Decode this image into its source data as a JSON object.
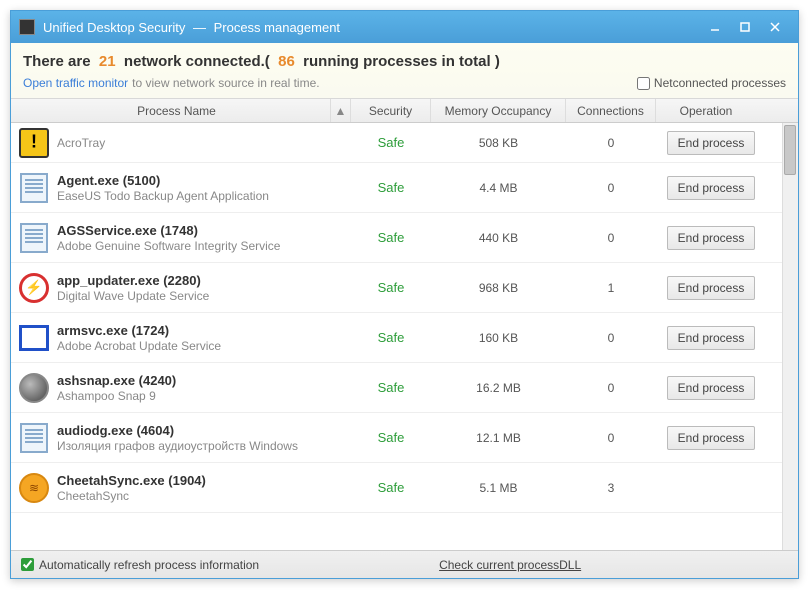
{
  "titlebar": {
    "app": "Unified Desktop Security",
    "separator": "—",
    "section": "Process management"
  },
  "header": {
    "prefix": "There are",
    "network_count": "21",
    "mid": "network connected.(",
    "total_count": "86",
    "suffix": "running processes in total )",
    "link": "Open traffic monitor",
    "link_tail": "to view network source in real time.",
    "checkbox_label": "Netconnected processes"
  },
  "columns": {
    "name": "Process Name",
    "sort": "▲",
    "security": "Security",
    "memory": "Memory Occupancy",
    "connections": "Connections",
    "operation": "Operation"
  },
  "safe_label": "Safe",
  "end_label": "End process",
  "rows": [
    {
      "icon": "ic-warn",
      "title": "",
      "sub": "AcroTray",
      "mem": "508 KB",
      "con": "0",
      "first": true
    },
    {
      "icon": "ic-doc",
      "title": "Agent.exe (5100)",
      "sub": "EaseUS Todo Backup Agent Application",
      "mem": "4.4 MB",
      "con": "0"
    },
    {
      "icon": "ic-doc",
      "title": "AGSService.exe (1748)",
      "sub": "Adobe Genuine Software Integrity Service",
      "mem": "440 KB",
      "con": "0"
    },
    {
      "icon": "ic-bolt",
      "title": "app_updater.exe (2280)",
      "sub": "Digital Wave Update Service",
      "mem": "968 KB",
      "con": "1"
    },
    {
      "icon": "ic-rect",
      "title": "armsvc.exe (1724)",
      "sub": "Adobe Acrobat Update Service",
      "mem": "160 KB",
      "con": "0"
    },
    {
      "icon": "ic-ball",
      "title": "ashsnap.exe (4240)",
      "sub": "Ashampoo Snap 9",
      "mem": "16.2 MB",
      "con": "0"
    },
    {
      "icon": "ic-doc",
      "title": "audiodg.exe (4604)",
      "sub": "Изоляция графов аудиоустройств Windows",
      "mem": "12.1 MB",
      "con": "0"
    },
    {
      "icon": "ic-cheetah",
      "title": "CheetahSync.exe (1904)",
      "sub": "CheetahSync",
      "mem": "5.1 MB",
      "con": "3",
      "last": true
    }
  ],
  "footer": {
    "auto_refresh": "Automatically refresh process information",
    "check_dll": "Check current processDLL"
  }
}
